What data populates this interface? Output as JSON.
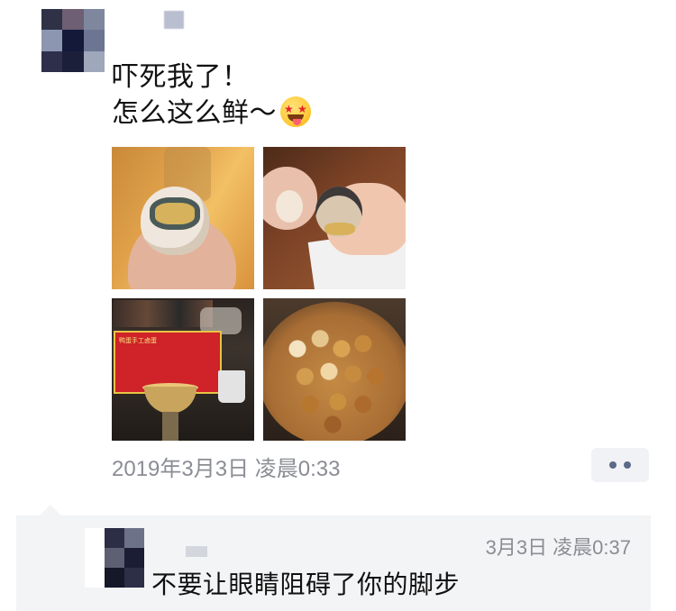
{
  "post": {
    "line1": "吓死我了！",
    "line2": "怎么这么鲜～",
    "emoji": "drooling-star-eyes-emoji",
    "timestamp": "2019年3月3日 凌晨0:33",
    "photos": [
      {
        "subject": "egg-in-hand"
      },
      {
        "subject": "hand-holding-egg-on-napkin"
      },
      {
        "subject": "street-stall-sign"
      },
      {
        "subject": "bowl-of-eggs"
      }
    ],
    "stall_sign_text": "鸭蛋手工卤蛋"
  },
  "comment": {
    "time": "3月3日 凌晨0:37",
    "text": "不要让眼睛阻碍了你的脚步"
  },
  "colors": {
    "meta_gray": "#8a8d93",
    "comment_bg": "#f3f4f6",
    "more_dots": "#5b6a87"
  }
}
